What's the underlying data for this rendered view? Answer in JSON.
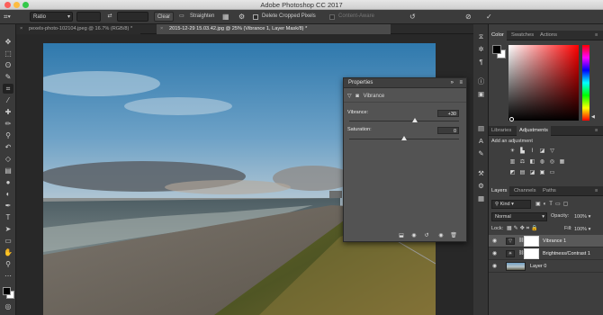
{
  "window": {
    "title": "Adobe Photoshop CC 2017"
  },
  "options_bar": {
    "ratio": "Ratio",
    "clear_label": "Clear",
    "straighten_label": "Straighten",
    "delete_cropped_label": "Delete Cropped Pixels",
    "content_aware_label": "Content-Aware"
  },
  "doc_tabs": [
    {
      "label": "pexels-photo-102104.jpeg @ 16.7% (RGB/8) *",
      "active": false
    },
    {
      "label": "2015-12-29 15.03.42.jpg @ 25% (Vibrance 1, Layer Mask/8) *",
      "active": true
    }
  ],
  "properties": {
    "title": "Properties",
    "adjustment_name": "Vibrance",
    "vibrance_label": "Vibrance:",
    "vibrance_value": "+30",
    "vibrance_fraction": 0.6,
    "saturation_label": "Saturation:",
    "saturation_value": "0",
    "saturation_fraction": 0.5
  },
  "right_panels": {
    "color_tabs": [
      "Color",
      "Swatches",
      "Actions"
    ],
    "lib_tabs": [
      "Libraries",
      "Adjustments"
    ],
    "add_adjustment": "Add an adjustment",
    "layers_tabs": [
      "Layers",
      "Channels",
      "Paths"
    ],
    "kind": "Kind",
    "blend_mode": "Normal",
    "opacity_label": "Opacity:",
    "opacity_value": "100%",
    "lock_label": "Lock:",
    "fill_label": "Fill:",
    "fill_value": "100%",
    "layers": [
      {
        "name": "Vibrance 1",
        "selected": true
      },
      {
        "name": "Brightness/Contrast 1",
        "selected": false
      },
      {
        "name": "Layer 0",
        "selected": false
      }
    ]
  },
  "colors": {
    "foreground": "#000000",
    "background": "#ffffff",
    "accent_hue": "#ff0000"
  }
}
